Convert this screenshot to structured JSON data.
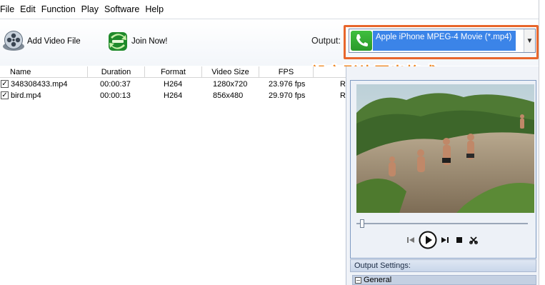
{
  "menu": [
    "File",
    "Edit",
    "Function",
    "Play",
    "Software",
    "Help"
  ],
  "toolbar": {
    "add_video": "Add Video File",
    "join_now": "Join Now!",
    "output_label": "Output:",
    "output_value": "Apple iPhone MPEG-4 Movie (*.mp4)"
  },
  "annotation": "設定影片匯出格式",
  "table": {
    "columns": [
      "Name",
      "Duration",
      "Format",
      "Video Size",
      "FPS"
    ],
    "rows": [
      {
        "name": "348308433.mp4",
        "duration": "00:00:37",
        "format": "H264",
        "size": "1280x720",
        "fps": "23.976 fps",
        "extra": "R",
        "checked": true
      },
      {
        "name": "bird.mp4",
        "duration": "00:00:13",
        "format": "H264",
        "size": "856x480",
        "fps": "29.970 fps",
        "extra": "R",
        "checked": true
      }
    ]
  },
  "panel": {
    "settings_header": "Output Settings:",
    "general": "General"
  },
  "colors": {
    "highlight": "#e8662c",
    "annotation": "#f08a26",
    "selection": "#3b84e8"
  },
  "icons": [
    "film-reel-icon",
    "join-arrows-icon",
    "phone-icon",
    "prev-icon",
    "play-icon",
    "next-icon",
    "stop-icon",
    "scissors-icon"
  ]
}
